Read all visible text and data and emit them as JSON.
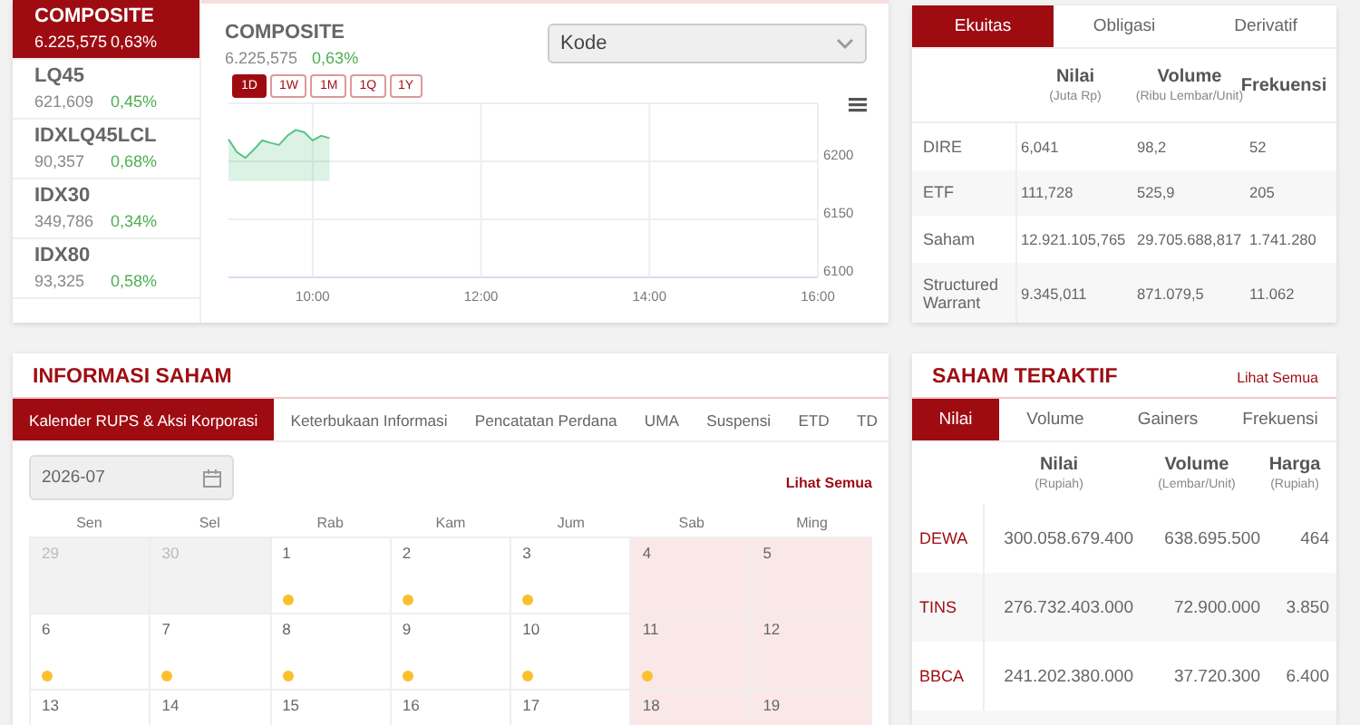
{
  "indices": [
    {
      "name": "COMPOSITE",
      "value": "6.225,575",
      "change": "0,63%",
      "selected": true
    },
    {
      "name": "LQ45",
      "value": "621,609",
      "change": "0,45%",
      "selected": false
    },
    {
      "name": "IDXLQ45LCL",
      "value": "90,357",
      "change": "0,68%",
      "selected": false
    },
    {
      "name": "IDX30",
      "value": "349,786",
      "change": "0,34%",
      "selected": false
    },
    {
      "name": "IDX80",
      "value": "93,325",
      "change": "0,58%",
      "selected": false
    }
  ],
  "index_chart": {
    "title": "COMPOSITE",
    "value": "6.225,575",
    "change": "0,63%",
    "periods": [
      {
        "label": "1D",
        "selected": true
      },
      {
        "label": "1W",
        "selected": false
      },
      {
        "label": "1M",
        "selected": false
      },
      {
        "label": "1Q",
        "selected": false
      },
      {
        "label": "1Y",
        "selected": false
      }
    ],
    "code_select": {
      "placeholder": "Kode"
    },
    "chart_data": {
      "type": "area",
      "x": [
        9.0,
        9.1,
        9.2,
        9.3,
        9.4,
        9.5,
        9.6,
        9.7,
        9.8,
        9.9,
        10.0,
        10.1,
        10.2
      ],
      "series": [
        {
          "color": "#5cc487",
          "values": [
            6219,
            6208,
            6203,
            6210,
            6218,
            6216,
            6214,
            6222,
            6227,
            6225,
            6218,
            6222,
            6220
          ]
        }
      ],
      "xlim": [
        9,
        16
      ],
      "ylim": [
        6100,
        6250
      ],
      "xticks": [
        {
          "value": 10,
          "label": "10:00"
        },
        {
          "value": 12,
          "label": "12:00"
        },
        {
          "value": 14,
          "label": "14:00"
        },
        {
          "value": 16,
          "label": "16:00"
        }
      ],
      "yticks": [
        6100,
        6150,
        6200
      ],
      "grid": true
    }
  },
  "market_summary": {
    "tabs": [
      {
        "label": "Ekuitas",
        "selected": true
      },
      {
        "label": "Obligasi",
        "selected": false
      },
      {
        "label": "Derivatif",
        "selected": false
      }
    ],
    "columns": [
      {
        "title": "Nilai",
        "unit": "(Juta Rp)"
      },
      {
        "title": "Volume",
        "unit": "(Ribu Lembar/Unit)"
      },
      {
        "title": "Frekuensi"
      }
    ],
    "rows": [
      {
        "label": "DIRE",
        "cells": [
          "6,041",
          "98,2",
          "52"
        ]
      },
      {
        "label": "ETF",
        "cells": [
          "111,728",
          "525,9",
          "205"
        ]
      },
      {
        "label": "Saham",
        "cells": [
          "12.921.105,765",
          "29.705.688,817",
          "1.741.280"
        ]
      },
      {
        "label": "Structured Warrant",
        "cells": [
          "9.345,011",
          "871.079,5",
          "11.062"
        ]
      }
    ]
  },
  "stock_info": {
    "title": "INFORMASI SAHAM",
    "tabs": [
      {
        "label": "Kalender RUPS & Aksi Korporasi",
        "selected": true
      },
      {
        "label": "Keterbukaan Informasi",
        "selected": false
      },
      {
        "label": "Pencatatan Perdana",
        "selected": false
      },
      {
        "label": "UMA",
        "selected": false
      },
      {
        "label": "Suspensi",
        "selected": false
      },
      {
        "label": "ETD",
        "selected": false
      },
      {
        "label": "TD",
        "selected": false
      }
    ],
    "month_field": {
      "value": "2026-07"
    },
    "see_all": "Lihat Semua",
    "weekdays": [
      "Sen",
      "Sel",
      "Rab",
      "Kam",
      "Jum",
      "Sab",
      "Ming"
    ],
    "days": [
      {
        "day": "29",
        "outside": true,
        "weekend": false,
        "event": false
      },
      {
        "day": "30",
        "outside": true,
        "weekend": false,
        "event": false
      },
      {
        "day": "1",
        "outside": false,
        "weekend": false,
        "event": true
      },
      {
        "day": "2",
        "outside": false,
        "weekend": false,
        "event": true
      },
      {
        "day": "3",
        "outside": false,
        "weekend": false,
        "event": true
      },
      {
        "day": "4",
        "outside": false,
        "weekend": true,
        "event": false
      },
      {
        "day": "5",
        "outside": false,
        "weekend": true,
        "event": false
      },
      {
        "day": "6",
        "outside": false,
        "weekend": false,
        "event": true
      },
      {
        "day": "7",
        "outside": false,
        "weekend": false,
        "event": true
      },
      {
        "day": "8",
        "outside": false,
        "weekend": false,
        "event": true
      },
      {
        "day": "9",
        "outside": false,
        "weekend": false,
        "event": true
      },
      {
        "day": "10",
        "outside": false,
        "weekend": false,
        "event": true
      },
      {
        "day": "11",
        "outside": false,
        "weekend": true,
        "event": true
      },
      {
        "day": "12",
        "outside": false,
        "weekend": true,
        "event": false
      },
      {
        "day": "13",
        "outside": false,
        "weekend": false,
        "event": false
      },
      {
        "day": "14",
        "outside": false,
        "weekend": false,
        "event": false
      },
      {
        "day": "15",
        "outside": false,
        "weekend": false,
        "event": false
      },
      {
        "day": "16",
        "outside": false,
        "weekend": false,
        "event": false
      },
      {
        "day": "17",
        "outside": false,
        "weekend": false,
        "event": false
      },
      {
        "day": "18",
        "outside": false,
        "weekend": true,
        "event": false
      },
      {
        "day": "19",
        "outside": false,
        "weekend": true,
        "event": false
      }
    ]
  },
  "most_active": {
    "title": "SAHAM TERAKTIF",
    "see_all": "Lihat Semua",
    "tabs": [
      {
        "label": "Nilai",
        "selected": true
      },
      {
        "label": "Volume",
        "selected": false
      },
      {
        "label": "Gainers",
        "selected": false
      },
      {
        "label": "Frekuensi",
        "selected": false
      }
    ],
    "columns": [
      {
        "title": "Nilai",
        "unit": "(Rupiah)"
      },
      {
        "title": "Volume",
        "unit": "(Lembar/Unit)"
      },
      {
        "title": "Harga",
        "unit": "(Rupiah)"
      }
    ],
    "rows": [
      {
        "code": "DEWA",
        "cells": [
          "300.058.679.400",
          "638.695.500",
          "464"
        ]
      },
      {
        "code": "TINS",
        "cells": [
          "276.732.403.000",
          "72.900.000",
          "3.850"
        ]
      },
      {
        "code": "BBCA",
        "cells": [
          "241.202.380.000",
          "37.720.300",
          "6.400"
        ]
      }
    ]
  }
}
